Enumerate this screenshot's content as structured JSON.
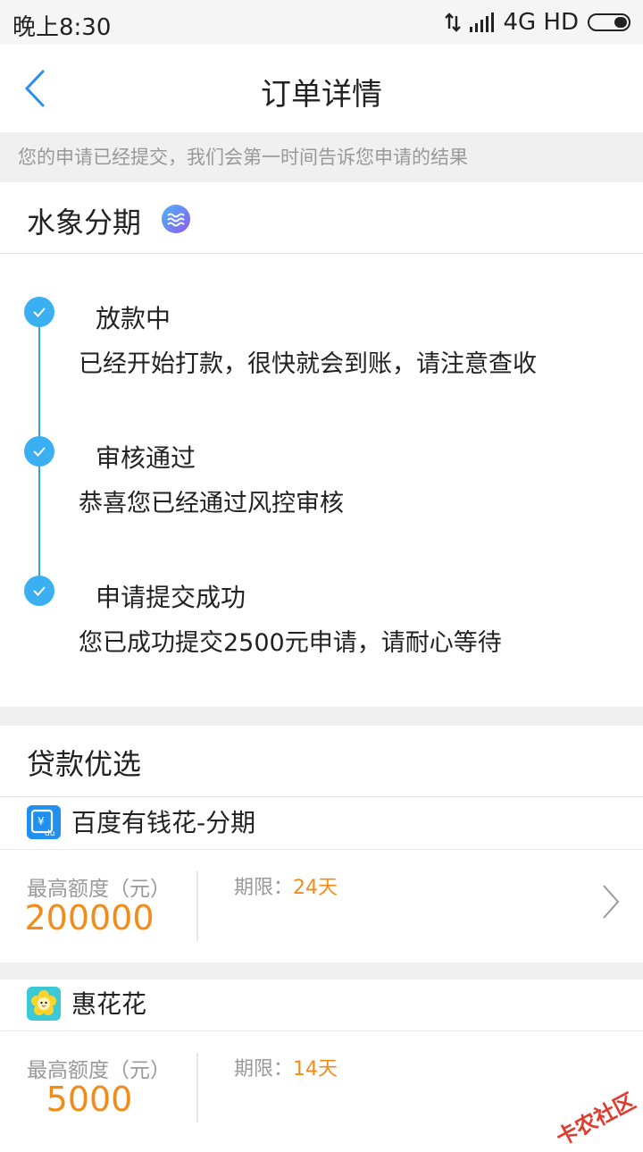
{
  "status_bar": {
    "time": "晚上8:30",
    "network": "4G HD",
    "icons": [
      "data-transfer-icon",
      "signal-icon",
      "battery-icon"
    ]
  },
  "header": {
    "title": "订单详情",
    "back_icon": "chevron-left-icon"
  },
  "notice": "您的申请已经提交，我们会第一时间告诉您申请的结果",
  "provider": {
    "name": "水象分期",
    "logo_icon": "water-wave-logo"
  },
  "timeline": {
    "steps": [
      {
        "title": "放款中",
        "desc": "已经开始打款，很快就会到账，请注意查收"
      },
      {
        "title": "审核通过",
        "desc": "恭喜您已经通过风控审核"
      },
      {
        "title": "申请提交成功",
        "desc": "您已成功提交2500元申请，请耐心等待"
      }
    ]
  },
  "recommend": {
    "title": "贷款优选",
    "items": [
      {
        "name": "百度有钱花-分期",
        "icon": "baidu-youqianhua-icon",
        "limit_label": "最高额度（元）",
        "limit_value": "200000",
        "term_label": "期限：",
        "term_value": "24天"
      },
      {
        "name": "惠花花",
        "icon": "flower-icon",
        "limit_label": "最高额度（元）",
        "limit_value": "5000",
        "term_label": "期限：",
        "term_value": "14天"
      }
    ]
  },
  "watermark": "卡农社区",
  "colors": {
    "accent_blue": "#3ab0f3",
    "amount_orange": "#f28b1a",
    "gray_bg": "#f0f0f0"
  }
}
